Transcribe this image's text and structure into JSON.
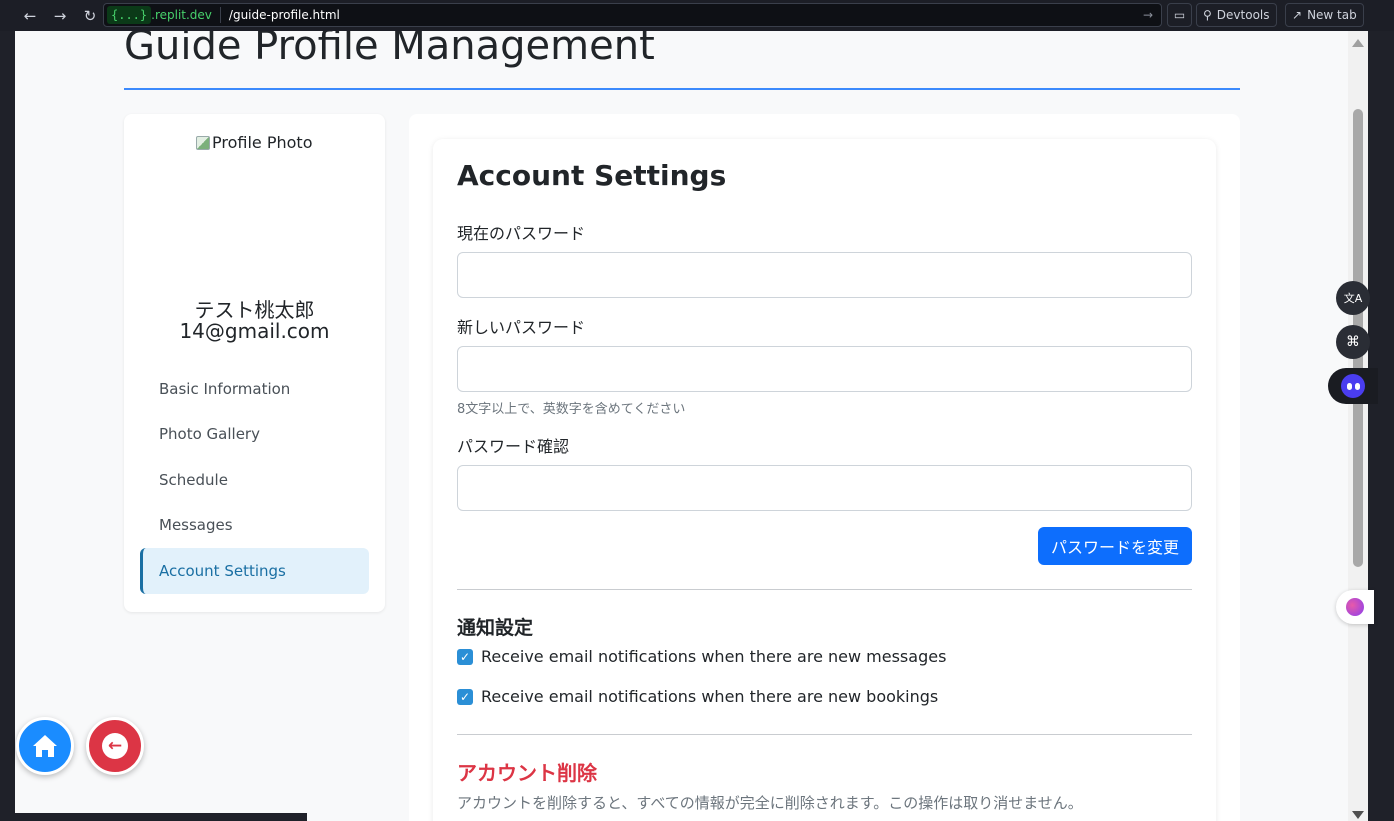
{
  "browser": {
    "domain_badge": "{...}",
    "domain": ".replit.dev",
    "path": "/guide-profile.html",
    "devtools_label": "Devtools",
    "newtab_label": "New tab"
  },
  "page": {
    "title": "Guide Profile Management"
  },
  "sidebar": {
    "photo_alt": "Profile Photo",
    "name": "テスト桃太郎",
    "email": "14@gmail.com",
    "items": [
      {
        "label": "Basic Information"
      },
      {
        "label": "Photo Gallery"
      },
      {
        "label": "Schedule"
      },
      {
        "label": "Messages"
      },
      {
        "label": "Account Settings",
        "active": true
      }
    ]
  },
  "account_settings": {
    "title": "Account Settings",
    "current_password_label": "現在のパスワード",
    "current_password_value": "",
    "new_password_label": "新しいパスワード",
    "new_password_value": "",
    "new_password_hint": "8文字以上で、英数字を含めてください",
    "confirm_password_label": "パスワード確認",
    "confirm_password_value": "",
    "change_password_button": "パスワードを変更",
    "notifications_title": "通知設定",
    "notify_messages_label": "Receive email notifications when there are new messages",
    "notify_messages_checked": true,
    "notify_bookings_label": "Receive email notifications when there are new bookings",
    "notify_bookings_checked": true,
    "delete_title": "アカウント削除",
    "delete_text": "アカウントを削除すると、すべての情報が完全に削除されます。この操作は取り消せません。"
  },
  "colors": {
    "primary": "#0d6efd",
    "danger": "#dc3545",
    "active_nav_bg": "#e2f1fb",
    "active_nav_text": "#1a6fa3"
  },
  "floating": {
    "home_icon": "home-icon",
    "back_icon": "arrow-left-icon"
  }
}
